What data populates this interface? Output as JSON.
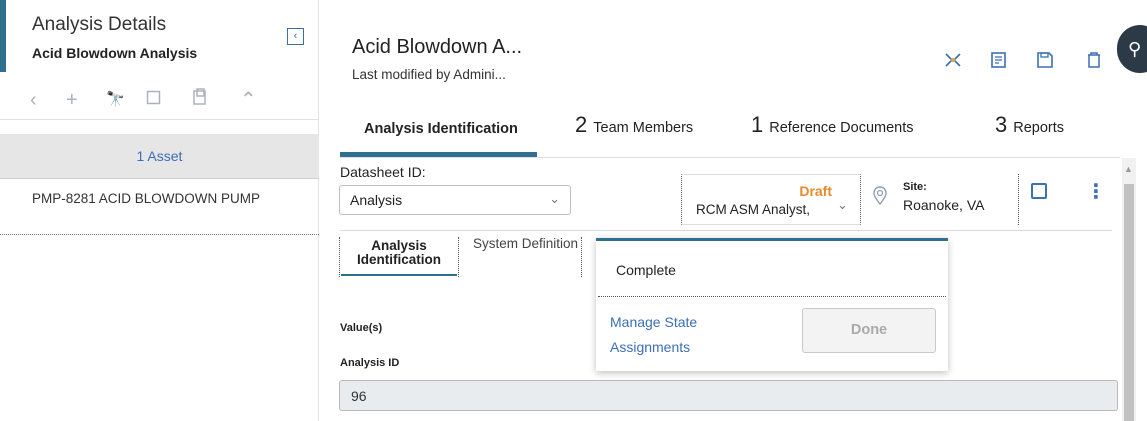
{
  "left_panel": {
    "title": "Analysis Details",
    "subtitle": "Acid Blowdown Analysis",
    "collapse_icon": "chevron-left-icon",
    "toolbar_icons": [
      "chevron-left-icon",
      "plus-icon",
      "binoculars-icon",
      "copy-icon",
      "paste-icon",
      "chevron-up-icon"
    ],
    "asset_header": "1 Asset",
    "asset_item": "PMP-8281 ACID BLOWDOWN PUMP"
  },
  "header": {
    "title": "Acid Blowdown A...",
    "subtitle": "Last modified by Admini...",
    "icons": [
      "asset-hierarchy-icon",
      "report-icon",
      "save-icon",
      "delete-icon"
    ],
    "guide_button_icon": "guided-collapse-icon"
  },
  "tabs": [
    {
      "number": "",
      "label": "Analysis Identification",
      "active": true
    },
    {
      "number": "2",
      "label": "Team Members",
      "active": false
    },
    {
      "number": "1",
      "label": "Reference Documents",
      "active": false
    },
    {
      "number": "3",
      "label": "Reports",
      "active": false
    }
  ],
  "datasheet": {
    "label": "Datasheet ID:",
    "selected": "Analysis"
  },
  "state": {
    "status": "Draft",
    "assignee": "RCM ASM Analyst,",
    "status_color": "#e8892b"
  },
  "site": {
    "label": "Site:",
    "value": "Roanoke, VA"
  },
  "subtabs": [
    {
      "label": "Analysis Identification"
    },
    {
      "label": "System Definition"
    }
  ],
  "form": {
    "values_label": "Value(s)",
    "analysis_id_label": "Analysis ID",
    "analysis_id_value": "96"
  },
  "popover": {
    "option": "Complete",
    "link_line1": "Manage State",
    "link_line2": "Assignments",
    "done_label": "Done"
  }
}
